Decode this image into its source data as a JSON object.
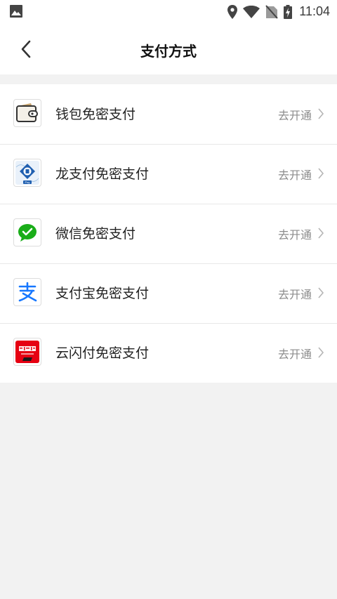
{
  "status_bar": {
    "time": "11:04",
    "icons": [
      "image-icon",
      "location-icon",
      "wifi-icon",
      "no-sim-icon",
      "battery-charging-icon"
    ]
  },
  "nav": {
    "title": "支付方式",
    "back_icon": "chevron-left-icon"
  },
  "payment_methods": [
    {
      "label": "钱包免密支付",
      "action": "去开通",
      "icon": "wallet-icon"
    },
    {
      "label": "龙支付免密支付",
      "action": "去开通",
      "icon": "longpay-icon"
    },
    {
      "label": "微信免密支付",
      "action": "去开通",
      "icon": "wechat-icon"
    },
    {
      "label": "支付宝免密支付",
      "action": "去开通",
      "icon": "alipay-icon"
    },
    {
      "label": "云闪付免密支付",
      "action": "去开通",
      "icon": "unionpay-quickpass-icon"
    }
  ],
  "colors": {
    "background": "#f2f2f2",
    "wechat_green": "#1aad19",
    "alipay_blue": "#1677ff",
    "quickpass_red": "#e60012",
    "longpay_blue": "#1f5fb0"
  }
}
